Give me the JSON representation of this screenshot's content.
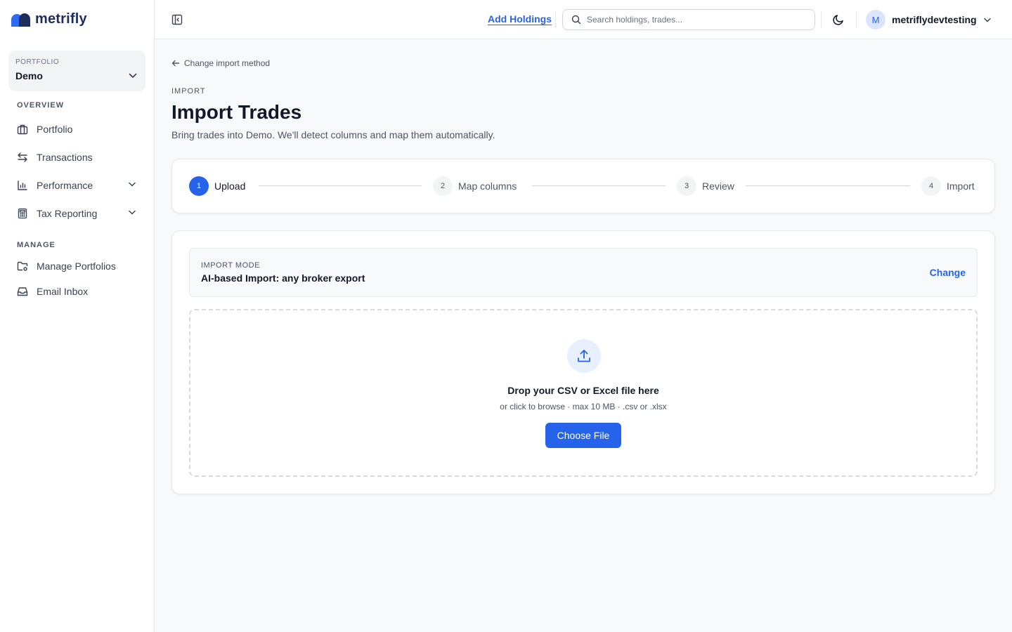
{
  "brand": {
    "name": "metrifly",
    "accent": "#2563eb",
    "logo_color": "#1f2d5c"
  },
  "sidebar": {
    "portfolio_label": "PORTFOLIO",
    "portfolio_value": "Demo",
    "overview_label": "OVERVIEW",
    "manage_label": "MANAGE",
    "overview_items": [
      {
        "label": "Portfolio",
        "icon": "briefcase-icon"
      },
      {
        "label": "Transactions",
        "icon": "arrows-swap-icon"
      },
      {
        "label": "Performance",
        "icon": "bar-chart-icon",
        "expandable": true
      },
      {
        "label": "Tax Reporting",
        "icon": "calculator-icon",
        "expandable": true
      }
    ],
    "manage_items": [
      {
        "label": "Manage Portfolios",
        "icon": "folder-settings-icon"
      },
      {
        "label": "Email Inbox",
        "icon": "inbox-icon"
      }
    ]
  },
  "header": {
    "add_holdings": "Add Holdings",
    "search_placeholder": "Search holdings, trades...",
    "theme_icon": "moon-icon",
    "avatar_initial": "M",
    "username": "metriflydevtesting"
  },
  "page": {
    "back_link": "Change import method",
    "eyebrow": "IMPORT",
    "title": "Import Trades",
    "subtitle": "Bring trades into Demo. We'll detect columns and map them automatically."
  },
  "stepper": {
    "steps": [
      {
        "num": "1",
        "label": "Upload",
        "active": true
      },
      {
        "num": "2",
        "label": "Map columns",
        "active": false
      },
      {
        "num": "3",
        "label": "Review",
        "active": false
      },
      {
        "num": "4",
        "label": "Import",
        "active": false
      }
    ]
  },
  "import_mode": {
    "label": "IMPORT MODE",
    "value": "AI-based Import: any broker export",
    "change": "Change"
  },
  "dropzone": {
    "icon": "upload-icon",
    "title": "Drop your CSV or Excel file here",
    "hint": "or click to browse · max 10 MB · .csv or .xlsx",
    "button": "Choose File"
  }
}
